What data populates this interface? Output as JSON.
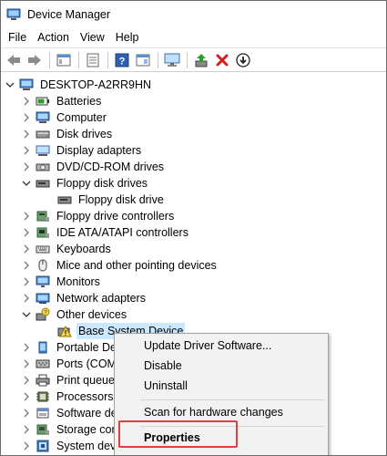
{
  "window": {
    "title": "Device Manager"
  },
  "menu": [
    "File",
    "Action",
    "View",
    "Help"
  ],
  "toolbar": {
    "buttons": [
      "back-arrow-icon",
      "forward-arrow-icon",
      "show-hide-console-tree-icon",
      "properties-sheet-icon",
      "help-icon",
      "action-pane-icon",
      "monitor-scan-icon",
      "update-driver-icon",
      "uninstall-x-icon",
      "disable-down-arrow-icon"
    ]
  },
  "tree": {
    "root": "DESKTOP-A2RR9HN",
    "items": [
      {
        "label": "Batteries",
        "icon": "battery-icon",
        "expanded": false
      },
      {
        "label": "Computer",
        "icon": "computer-icon",
        "expanded": false
      },
      {
        "label": "Disk drives",
        "icon": "disk-drive-icon",
        "expanded": false
      },
      {
        "label": "Display adapters",
        "icon": "display-adapter-icon",
        "expanded": false
      },
      {
        "label": "DVD/CD-ROM drives",
        "icon": "dvd-icon",
        "expanded": false
      },
      {
        "label": "Floppy disk drives",
        "icon": "floppy-icon",
        "expanded": true
      },
      {
        "label": "Floppy disk drive",
        "icon": "floppy-device-icon",
        "child": true
      },
      {
        "label": "Floppy drive controllers",
        "icon": "floppy-controller-icon",
        "expanded": false
      },
      {
        "label": "IDE ATA/ATAPI controllers",
        "icon": "ide-controller-icon",
        "expanded": false
      },
      {
        "label": "Keyboards",
        "icon": "keyboard-icon",
        "expanded": false
      },
      {
        "label": "Mice and other pointing devices",
        "icon": "mouse-icon",
        "expanded": false
      },
      {
        "label": "Monitors",
        "icon": "monitor-icon",
        "expanded": false
      },
      {
        "label": "Network adapters",
        "icon": "network-adapter-icon",
        "expanded": false
      },
      {
        "label": "Other devices",
        "icon": "other-devices-icon",
        "expanded": true
      },
      {
        "label": "Base System Device",
        "icon": "warning-device-icon",
        "child": true,
        "selected": true
      },
      {
        "label": "Portable De",
        "icon": "portable-device-icon",
        "expanded": false
      },
      {
        "label": "Ports (COM",
        "icon": "ports-icon",
        "expanded": false
      },
      {
        "label": "Print queue",
        "icon": "printer-icon",
        "expanded": false
      },
      {
        "label": "Processors",
        "icon": "processor-icon",
        "expanded": false
      },
      {
        "label": "Software de",
        "icon": "software-device-icon",
        "expanded": false
      },
      {
        "label": "Storage cor",
        "icon": "storage-icon",
        "expanded": false
      },
      {
        "label": "System dev",
        "icon": "system-device-icon",
        "expanded": false
      }
    ]
  },
  "context_menu": {
    "items": [
      "Update Driver Software...",
      "Disable",
      "Uninstall",
      "Scan for hardware changes",
      "Properties"
    ],
    "highlighted": "Properties"
  },
  "colors": {
    "selection": "#cce8ff",
    "highlight_border": "#e04040",
    "menu_bg": "#f2f2f2"
  }
}
